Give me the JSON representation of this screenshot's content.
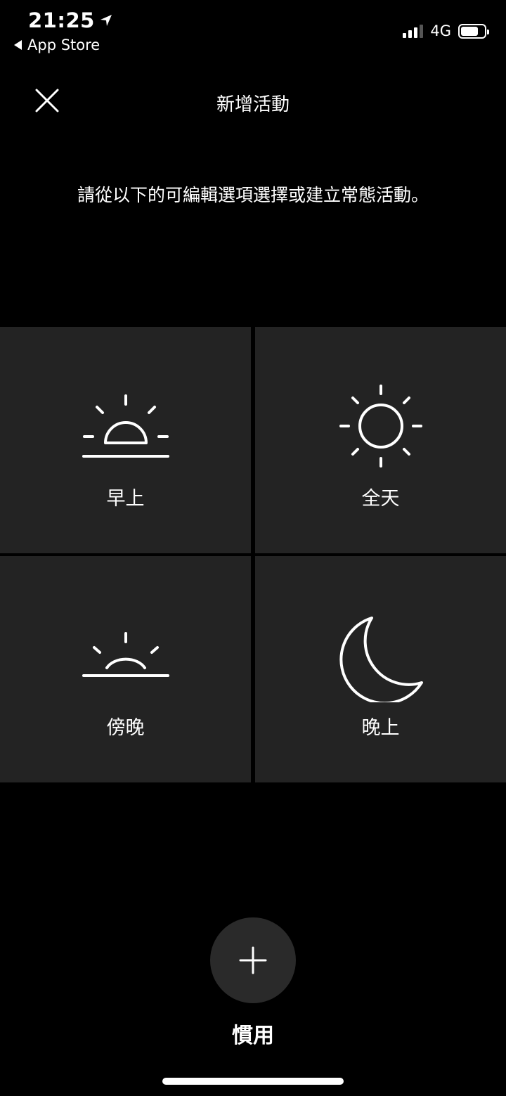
{
  "status_bar": {
    "time": "21:25",
    "back_app": "App Store",
    "network": "4G"
  },
  "header": {
    "title": "新增活動"
  },
  "instruction": "請從以下的可編輯選項選擇或建立常態活動。",
  "tiles": [
    {
      "label": "早上",
      "icon": "sunrise-icon"
    },
    {
      "label": "全天",
      "icon": "sun-icon"
    },
    {
      "label": "傍晚",
      "icon": "sunset-icon"
    },
    {
      "label": "晚上",
      "icon": "moon-icon"
    }
  ],
  "custom": {
    "label": "慣用",
    "icon": "plus-icon"
  },
  "colors": {
    "background": "#000000",
    "tile": "#232323",
    "fab": "#2a2a2a",
    "text": "#ffffff"
  }
}
